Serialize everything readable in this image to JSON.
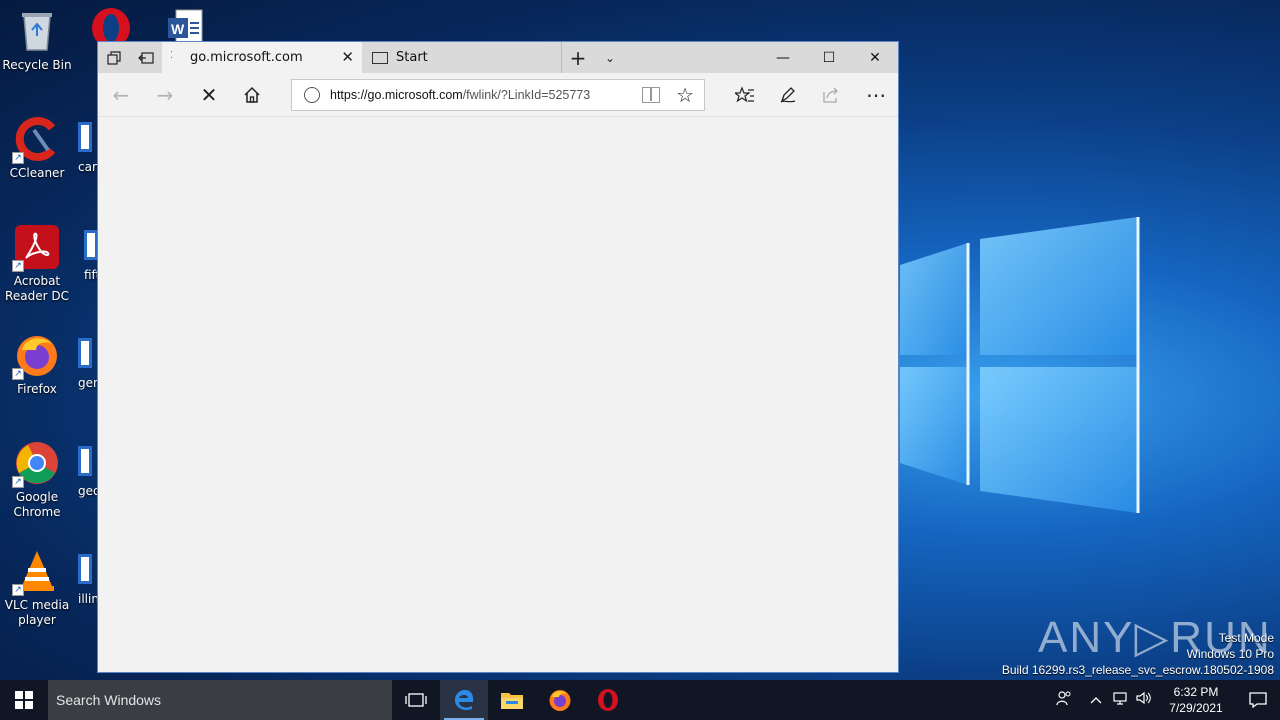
{
  "desktop": {
    "icons": [
      {
        "label": "Recycle Bin"
      },
      {
        "label": "CCleaner"
      },
      {
        "label": "Acrobat Reader DC"
      },
      {
        "label": "Firefox"
      },
      {
        "label": "Google Chrome"
      },
      {
        "label": "VLC media player"
      }
    ],
    "partial_icons": [
      {
        "label": "card"
      },
      {
        "label": "fift"
      },
      {
        "label": "gen"
      },
      {
        "label": "geo"
      },
      {
        "label": "illin"
      }
    ]
  },
  "browser": {
    "tabs": [
      {
        "label": "go.microsoft.com",
        "active": true
      },
      {
        "label": "Start",
        "active": false
      }
    ],
    "address": {
      "url_host": "https://go.microsoft.com",
      "url_path": "/fwlink/?LinkId=525773"
    }
  },
  "watermark": {
    "brand": "ANY▷RUN",
    "test_mode": "Test Mode",
    "edition": "Windows 10 Pro",
    "build": "Build 16299.rs3_release_svc_escrow.180502-1908"
  },
  "taskbar": {
    "search_placeholder": "Search Windows",
    "time": "6:32 PM",
    "date": "7/29/2021"
  }
}
